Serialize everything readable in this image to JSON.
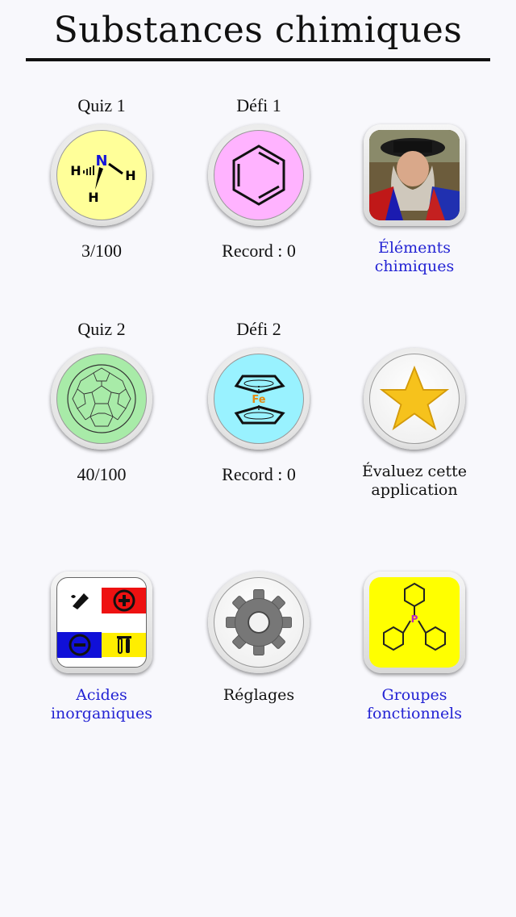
{
  "header": {
    "title": "Substances chimiques"
  },
  "row1": {
    "quiz1": {
      "label": "Quiz 1",
      "score": "3/100"
    },
    "defi1": {
      "label": "Défi 1",
      "record": "Record : 0"
    },
    "elements": {
      "line1": "Éléments",
      "line2": "chimiques"
    }
  },
  "row2": {
    "quiz2": {
      "label": "Quiz 2",
      "score": "40/100"
    },
    "defi2": {
      "label": "Défi 2",
      "record": "Record : 0"
    },
    "rate": {
      "line1": "Évaluez cette",
      "line2": "application"
    }
  },
  "row3": {
    "acides": {
      "line1": "Acides",
      "line2": "inorganiques"
    },
    "reglages": {
      "label": "Réglages"
    },
    "groupes": {
      "line1": "Groupes",
      "line2": "fonctionnels"
    }
  },
  "icons": {
    "ammonia": {
      "n": "N",
      "h1": "H",
      "h2": "H",
      "h3": "H"
    },
    "ferrocene": {
      "fe": "Fe"
    },
    "phosphine": {
      "p": "P"
    }
  },
  "colors": {
    "link": "#2323d4",
    "quiz1_bg": "#ffff99",
    "defi1_bg": "#ffb3ff",
    "quiz2_bg": "#a8eba8",
    "defi2_bg": "#99f2ff",
    "star": "#f6c21c",
    "groupes_bg": "#ffff00"
  }
}
